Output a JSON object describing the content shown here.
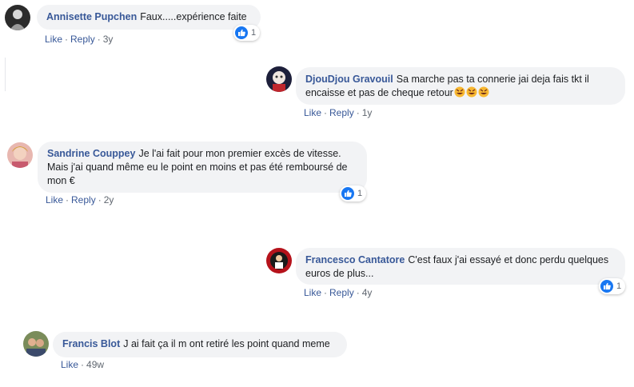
{
  "comments": [
    {
      "author": "Annisette Pupchen",
      "text": "Faux.....expérience faite",
      "like": "Like",
      "reply": "Reply",
      "time": "3y",
      "reactions": "1"
    },
    {
      "author": "DjouDjou Gravouil",
      "text": "Sa marche pas ta connerie jai deja fais tkt il encaisse et pas de cheque retour",
      "like": "Like",
      "reply": "Reply",
      "time": "1y"
    },
    {
      "author": "Sandrine Couppey",
      "text": "Je l'ai fait pour mon premier excès de vitesse. Mais j'ai quand même eu le point en moins et pas été remboursé de mon €",
      "like": "Like",
      "reply": "Reply",
      "time": "2y",
      "reactions": "1"
    },
    {
      "author": "Francesco Cantatore",
      "text": "C'est faux j'ai essayé et donc perdu quelques euros de plus...",
      "like": "Like",
      "reply": "Reply",
      "time": "4y",
      "reactions": "1"
    },
    {
      "author": "Francis Blot",
      "text": "J ai fait ça il m ont retiré les point quand meme",
      "like": "Like",
      "time": "49w"
    }
  ],
  "icons": {
    "reaction": "like-icon",
    "emoji": "rolling-on-floor-laughing-emoji"
  },
  "colors": {
    "author": "#385898",
    "bubble": "#f2f3f5",
    "like_reaction": "#1877f2"
  }
}
